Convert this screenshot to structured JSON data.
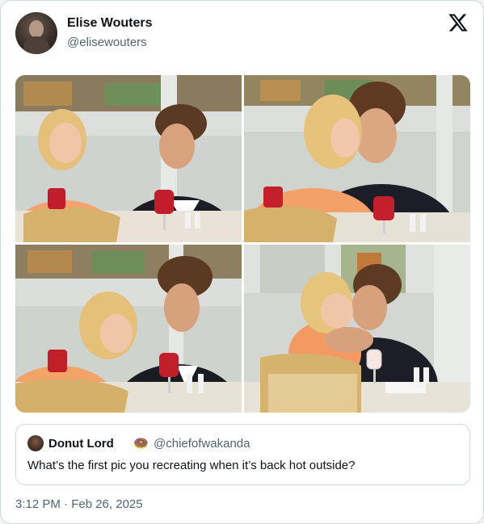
{
  "post": {
    "author_name": "Elise Wouters",
    "author_handle": "@elisewouters",
    "timestamp": "3:12 PM · Feb 26, 2025"
  },
  "quoted_post": {
    "author_name": "Donut Lord",
    "author_emoji": "🍩",
    "author_handle": "@chiefofwakanda",
    "text": "What’s the first pic you recreating when it’s back hot outside?"
  },
  "icons": {
    "platform_logo": "x-logo-icon"
  },
  "colors": {
    "text_primary": "#0f1419",
    "text_secondary": "#536471",
    "border": "#cfd9de"
  }
}
